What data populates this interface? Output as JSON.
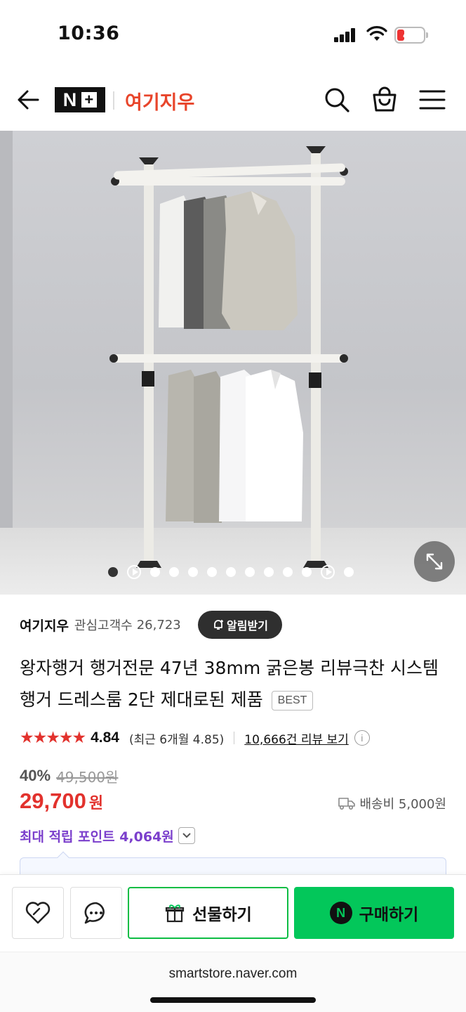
{
  "status_bar": {
    "time": "10:36",
    "battery_level": "4"
  },
  "header": {
    "logo_text": "N",
    "store_name": "여기지우",
    "icons": [
      "back-arrow-icon",
      "search-icon",
      "shopping-bag-icon",
      "menu-icon"
    ]
  },
  "carousel": {
    "total_indicators": 13,
    "active_index": 0,
    "video_indicator_positions": [
      1,
      11
    ]
  },
  "seller": {
    "name": "여기지우",
    "followers_label": "관심고객수",
    "followers_count": "26,723",
    "alarm_button": "알림받기"
  },
  "product": {
    "title": "왕자행거 행거전문 47년 38mm 굵은봉 리뷰극찬 시스템행거 드레스룸 2단 제대로된 제품",
    "badge": "BEST"
  },
  "rating": {
    "stars": "★★★★★",
    "value": "4.84",
    "recent": "(최근 6개월 4.85)",
    "review_link": "10,666건 리뷰 보기",
    "info": "i"
  },
  "price": {
    "discount_rate": "40%",
    "original": "49,500원",
    "sale_value": "29,700",
    "sale_unit": "원",
    "shipping": "배송비 5,000원"
  },
  "points": {
    "label": "최대 적립 포인트 4,064원"
  },
  "actions": {
    "gift_label": "선물하기",
    "buy_label": "구매하기",
    "npay_letter": "N"
  },
  "browser": {
    "url": "smartstore.naver.com"
  },
  "colors": {
    "brand_red": "#e8452b",
    "price_red": "#e2322d",
    "points_purple": "#7b3fcc",
    "naver_green": "#03c75a"
  }
}
